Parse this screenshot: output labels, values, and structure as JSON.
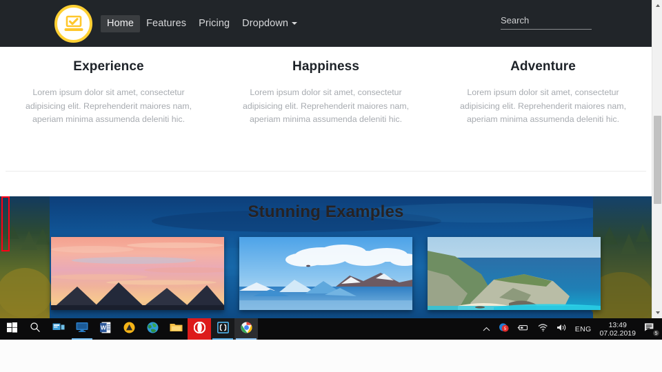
{
  "browser": {
    "navbar": {
      "brand_icon": "laptop-check-icon",
      "brand_color": "#ffd033",
      "links": [
        {
          "label": "Home",
          "active": true
        },
        {
          "label": "Features",
          "active": false
        },
        {
          "label": "Pricing",
          "active": false
        },
        {
          "label": "Dropdown",
          "active": false,
          "has_caret": true
        }
      ],
      "search": {
        "placeholder": "Search",
        "value": ""
      },
      "background": "#212529"
    },
    "features": [
      {
        "title": "Experience",
        "text": "Lorem ipsum dolor sit amet, consectetur adipisicing elit. Reprehenderit maiores nam, aperiam minima assumenda deleniti hic."
      },
      {
        "title": "Happiness",
        "text": "Lorem ipsum dolor sit amet, consectetur adipisicing elit. Reprehenderit maiores nam, aperiam minima assumenda deleniti hic."
      },
      {
        "title": "Adventure",
        "text": "Lorem ipsum dolor sit amet, consectetur adipisicing elit. Reprehenderit maiores nam, aperiam minima assumenda deleniti hic."
      }
    ],
    "hero": {
      "title": "Stunning Examples",
      "background_image": "forest-lake-landscape",
      "cards": [
        {
          "name": "sunset-mountains-photo"
        },
        {
          "name": "glacier-lagoon-icebergs-photo"
        },
        {
          "name": "navagio-beach-cove-photo"
        }
      ]
    },
    "scrollbar": {
      "up_arrow": "scroll-up-arrow",
      "down_arrow": "scroll-down-arrow"
    },
    "annotation": {
      "name": "red-highlight-box",
      "color": "#ff0016"
    }
  },
  "taskbar": {
    "items": [
      {
        "name": "start-button",
        "icon": "windows-logo-icon",
        "running": false
      },
      {
        "name": "search-button",
        "icon": "magnifier-icon",
        "running": false
      },
      {
        "name": "task-view-button",
        "icon": "task-view-icon",
        "running": false
      },
      {
        "name": "display-app",
        "icon": "monitor-icon",
        "running": true
      },
      {
        "name": "word-app",
        "icon": "word-icon",
        "running": false
      },
      {
        "name": "amber-app",
        "icon": "triangle-amber-icon",
        "running": false
      },
      {
        "name": "internet-app",
        "icon": "globe-icon",
        "running": false
      },
      {
        "name": "explorer-app",
        "icon": "folder-icon",
        "running": false
      },
      {
        "name": "opera-app",
        "icon": "opera-icon",
        "running": false
      },
      {
        "name": "brackets-app",
        "icon": "brackets-icon",
        "running": true
      },
      {
        "name": "chrome-app",
        "icon": "chrome-icon",
        "running": true
      }
    ],
    "tray": {
      "overflow_icon": "chevron-up-icon",
      "items": [
        {
          "name": "security-tray-icon",
          "icon": "shield-badge-icon"
        },
        {
          "name": "removable-media-icon",
          "icon": "usb-eject-icon"
        },
        {
          "name": "network-icon",
          "icon": "wifi-icon"
        },
        {
          "name": "volume-icon",
          "icon": "speaker-icon"
        }
      ],
      "language": "ENG",
      "time": "13:49",
      "date": "07.02.2019",
      "notifications": {
        "icon": "action-center-icon",
        "count": "5"
      }
    }
  }
}
